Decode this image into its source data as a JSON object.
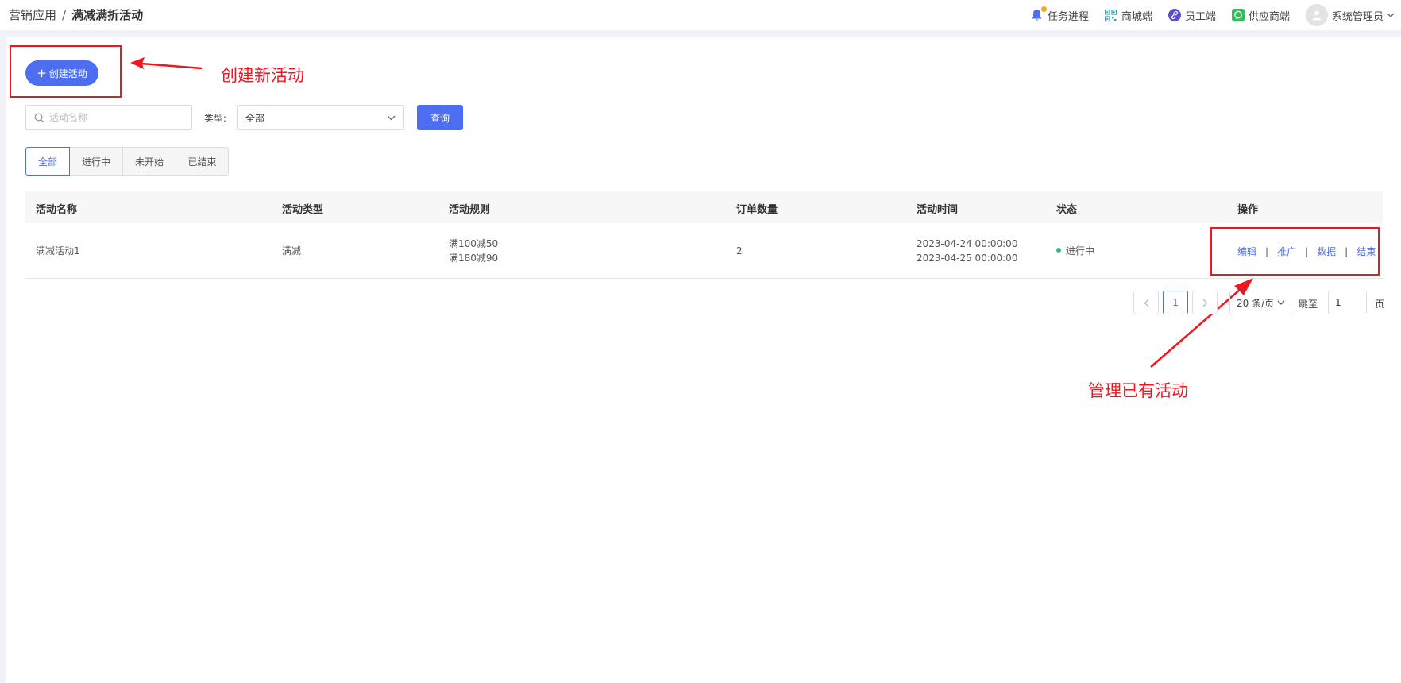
{
  "breadcrumb": {
    "parent": "营销应用",
    "separator": "/",
    "current": "满减满折活动"
  },
  "topbar": {
    "task_progress": "任务进程",
    "mall_end": "商城端",
    "staff_end": "员工端",
    "supplier_end": "供应商端",
    "user_name": "系统管理员"
  },
  "toolbar": {
    "create_label": "创建活动",
    "search_placeholder": "活动名称",
    "type_label": "类型:",
    "type_value": "全部",
    "query_label": "查询"
  },
  "tabs": [
    {
      "label": "全部",
      "active": true
    },
    {
      "label": "进行中",
      "active": false
    },
    {
      "label": "未开始",
      "active": false
    },
    {
      "label": "已结束",
      "active": false
    }
  ],
  "table": {
    "columns": [
      "活动名称",
      "活动类型",
      "活动规则",
      "订单数量",
      "活动时间",
      "状态",
      "操作"
    ],
    "rows": [
      {
        "name": "满减活动1",
        "type": "满减",
        "rules": [
          "满100减50",
          "满180减90"
        ],
        "orders": "2",
        "time": [
          "2023-04-24 00:00:00",
          "2023-04-25 00:00:00"
        ],
        "status": "进行中",
        "actions": [
          "编辑",
          "推广",
          "数据",
          "结束"
        ]
      }
    ]
  },
  "pagination": {
    "current_page": "1",
    "page_size": "20 条/页",
    "jump_label": "跳至",
    "jump_value": "1",
    "page_unit": "页"
  },
  "annotations": {
    "create": "创建新活动",
    "manage": "管理已有活动"
  },
  "colors": {
    "primary": "#4e6ef2",
    "annotation": "#f4141e",
    "status_running": "#2cbf73"
  }
}
